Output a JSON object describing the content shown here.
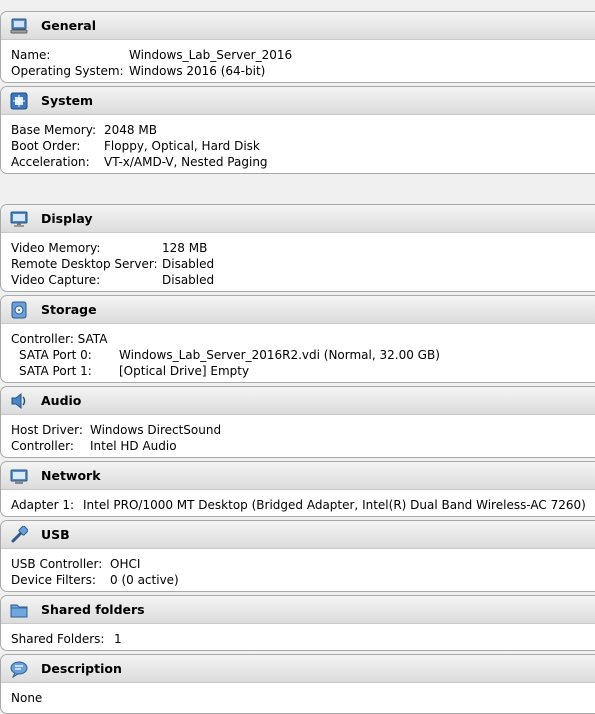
{
  "general": {
    "title": "General",
    "rows": [
      {
        "label": "Name:",
        "value": "Windows_Lab_Server_2016"
      },
      {
        "label": "Operating System:",
        "value": "Windows 2016 (64-bit)"
      }
    ]
  },
  "system": {
    "title": "System",
    "rows": [
      {
        "label": "Base Memory:",
        "value": "2048 MB"
      },
      {
        "label": "Boot Order:",
        "value": "Floppy, Optical, Hard Disk"
      },
      {
        "label": "Acceleration:",
        "value": "VT-x/AMD-V, Nested Paging"
      }
    ]
  },
  "display": {
    "title": "Display",
    "rows": [
      {
        "label": "Video Memory:",
        "value": "128 MB"
      },
      {
        "label": "Remote Desktop Server:",
        "value": "Disabled"
      },
      {
        "label": "Video Capture:",
        "value": "Disabled"
      }
    ]
  },
  "storage": {
    "title": "Storage",
    "controller": "Controller: SATA",
    "rows": [
      {
        "label": "SATA Port 0:",
        "value": "Windows_Lab_Server_2016R2.vdi (Normal, 32.00 GB)"
      },
      {
        "label": "SATA Port 1:",
        "value": "[Optical Drive] Empty"
      }
    ]
  },
  "audio": {
    "title": "Audio",
    "rows": [
      {
        "label": "Host Driver:",
        "value": "Windows DirectSound"
      },
      {
        "label": "Controller:",
        "value": "Intel HD Audio"
      }
    ]
  },
  "network": {
    "title": "Network",
    "rows": [
      {
        "label": "Adapter 1:",
        "value": "Intel PRO/1000 MT Desktop (Bridged Adapter, Intel(R) Dual Band Wireless-AC 7260)"
      }
    ]
  },
  "usb": {
    "title": "USB",
    "rows": [
      {
        "label": "USB Controller:",
        "value": "OHCI"
      },
      {
        "label": "Device Filters:",
        "value": "0 (0 active)"
      }
    ]
  },
  "shared_folders": {
    "title": "Shared folders",
    "rows": [
      {
        "label": "Shared Folders:",
        "value": "1"
      }
    ]
  },
  "description": {
    "title": "Description",
    "text": "None"
  },
  "icons": [
    "general-icon",
    "system-icon",
    "display-icon",
    "storage-icon",
    "audio-icon",
    "network-icon",
    "usb-icon",
    "shared-folders-icon",
    "description-icon"
  ]
}
